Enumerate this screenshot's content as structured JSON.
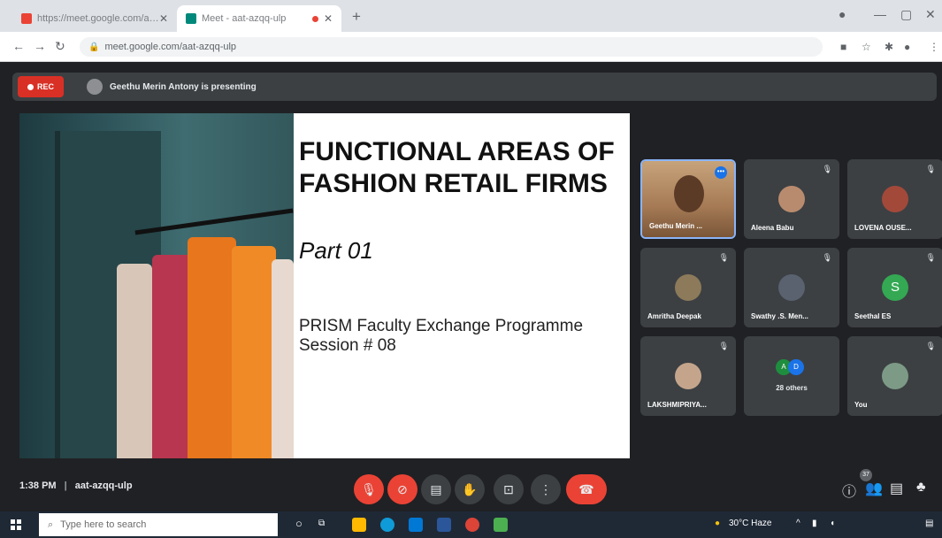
{
  "browser": {
    "tabs": [
      {
        "title": "https://meet.google.com/aat-a..."
      },
      {
        "title": "Meet - aat-azqq-ulp"
      }
    ],
    "address": "meet.google.com/aat-azqq-ulp"
  },
  "meet": {
    "rec_label": "REC",
    "presenting_text": "Geethu Merin Antony is presenting",
    "slide": {
      "title": "FUNCTIONAL AREAS OF FASHION RETAIL FIRMS",
      "subtitle": "Part 01",
      "line1": "PRISM Faculty Exchange Programme",
      "line2": "Session # 08"
    },
    "participants": [
      {
        "name": "Geethu Merin ..."
      },
      {
        "name": "Aleena Babu"
      },
      {
        "name": "LOVENA OUSE..."
      },
      {
        "name": "Amritha Deepak"
      },
      {
        "name": "Swathy .S. Men..."
      },
      {
        "name": "Seethal ES",
        "initial": "S"
      },
      {
        "name": "LAKSHMIPRIYA..."
      },
      {
        "name": "28 others",
        "initials": [
          "A",
          "D"
        ]
      },
      {
        "name": "You"
      }
    ],
    "meeting_time": "1:38 PM",
    "meeting_code": "aat-azqq-ulp",
    "people_count": "37"
  },
  "taskbar": {
    "search_placeholder": "Type here to search",
    "weather": "30°C Haze"
  },
  "colors": {
    "meet_bg": "#202124",
    "tile_bg": "#3c4043",
    "danger": "#ea4335"
  }
}
